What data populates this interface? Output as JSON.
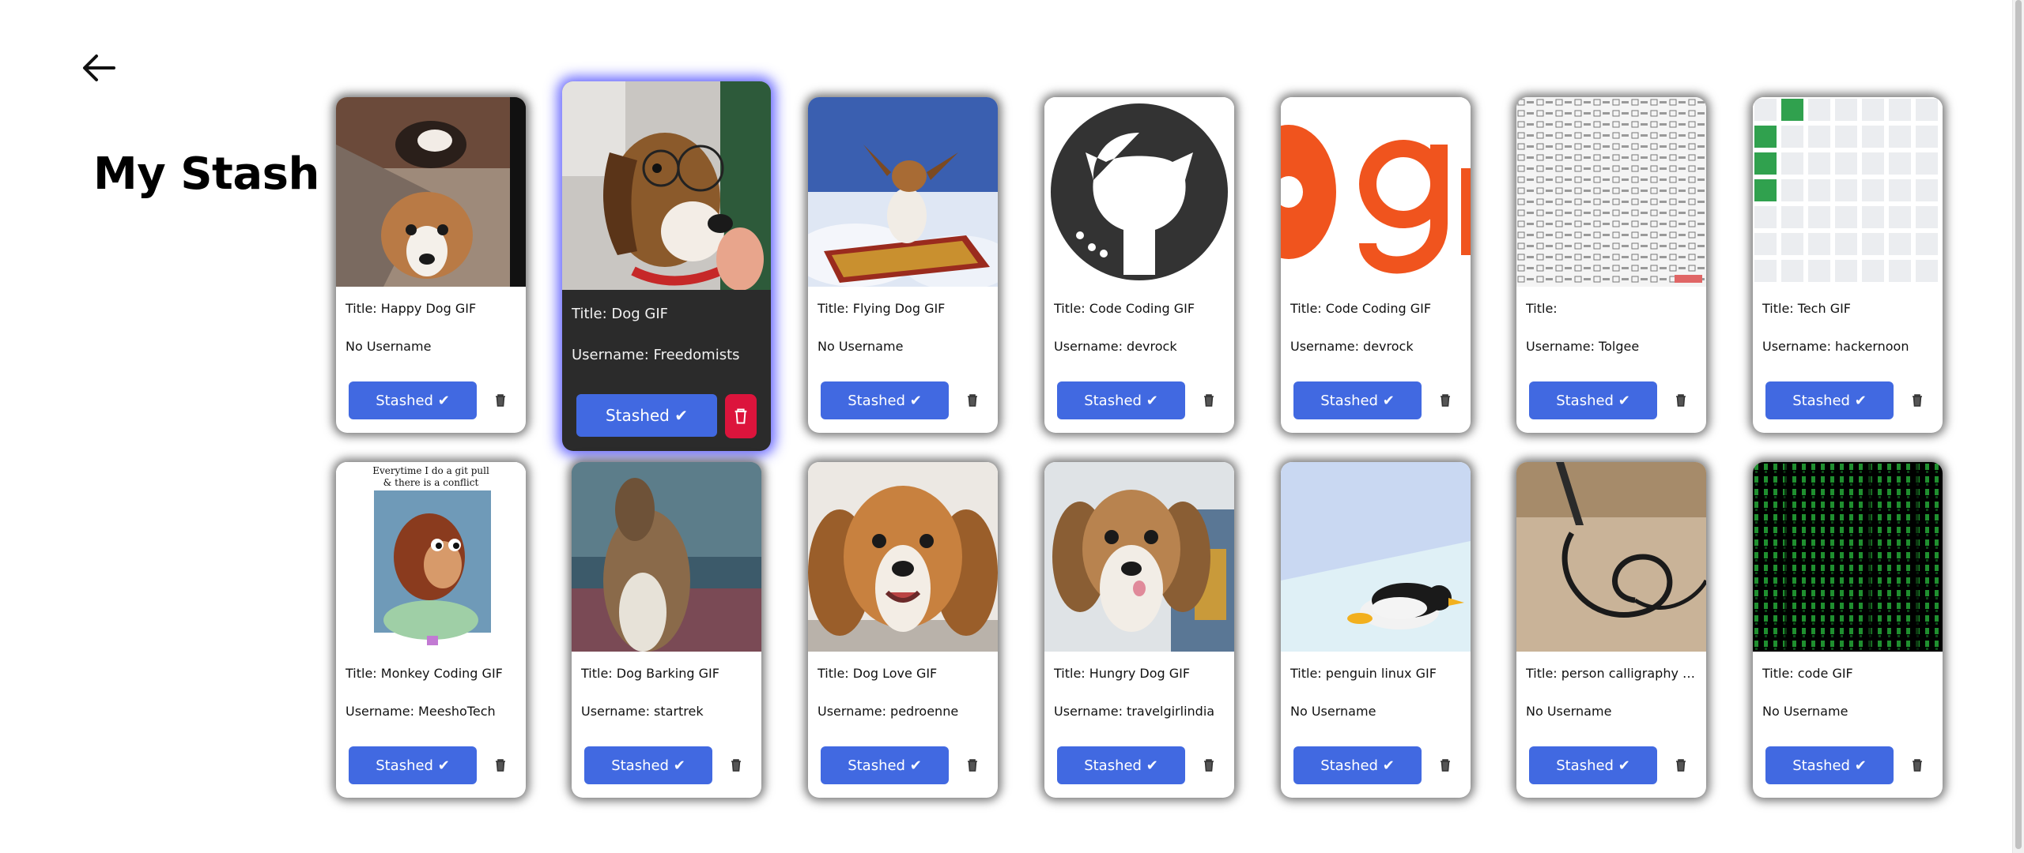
{
  "page": {
    "title": "My Stash",
    "back_icon": "arrow-left-icon"
  },
  "colors": {
    "stash_button": "#4169e1",
    "delete_active": "#dc143c",
    "active_card_bg": "#2b2b2b",
    "active_glow": "#5050ff"
  },
  "cards": [
    {
      "title": "Title: Happy Dog GIF",
      "user": "No Username",
      "button": "Stashed ✔",
      "media": "happy-dog"
    },
    {
      "title": "Title: Dog GIF",
      "user": "Username: Freedomists",
      "button": "Stashed ✔",
      "media": "dog-glasses"
    },
    {
      "title": "Title: Flying Dog GIF",
      "user": "No Username",
      "button": "Stashed ✔",
      "media": "flying-dog"
    },
    {
      "title": "Title: Code Coding GIF",
      "user": "Username: devrock",
      "button": "Stashed ✔",
      "media": "github-logo"
    },
    {
      "title": "Title: Code Coding GIF",
      "user": "Username: devrock",
      "button": "Stashed ✔",
      "media": "git-logo"
    },
    {
      "title": "Title:",
      "user": "Username: Tolgee",
      "button": "Stashed ✔",
      "media": "star-pattern"
    },
    {
      "title": "Title: Tech GIF",
      "user": "Username: hackernoon",
      "button": "Stashed ✔",
      "media": "contribution-grid"
    },
    {
      "title": "Title: Monkey Coding GIF",
      "user": "Username: MeeshoTech",
      "button": "Stashed ✔",
      "media": "monkey-meme",
      "caption": "Everytime I do a git pull\n& there is a conflict"
    },
    {
      "title": "Title: Dog Barking GIF",
      "user": "Username: startrek",
      "button": "Stashed ✔",
      "media": "dog-barking"
    },
    {
      "title": "Title: Dog Love GIF",
      "user": "Username: pedroenne",
      "button": "Stashed ✔",
      "media": "dog-love"
    },
    {
      "title": "Title: Hungry Dog GIF",
      "user": "Username: travelgirlindia",
      "button": "Stashed ✔",
      "media": "hungry-dog"
    },
    {
      "title": "Title: penguin linux GIF",
      "user": "No Username",
      "button": "Stashed ✔",
      "media": "penguin"
    },
    {
      "title": "Title: person calligraphy G...",
      "user": "No Username",
      "button": "Stashed ✔",
      "media": "calligraphy"
    },
    {
      "title": "Title: code GIF",
      "user": "No Username",
      "button": "Stashed ✔",
      "media": "matrix-code"
    }
  ]
}
